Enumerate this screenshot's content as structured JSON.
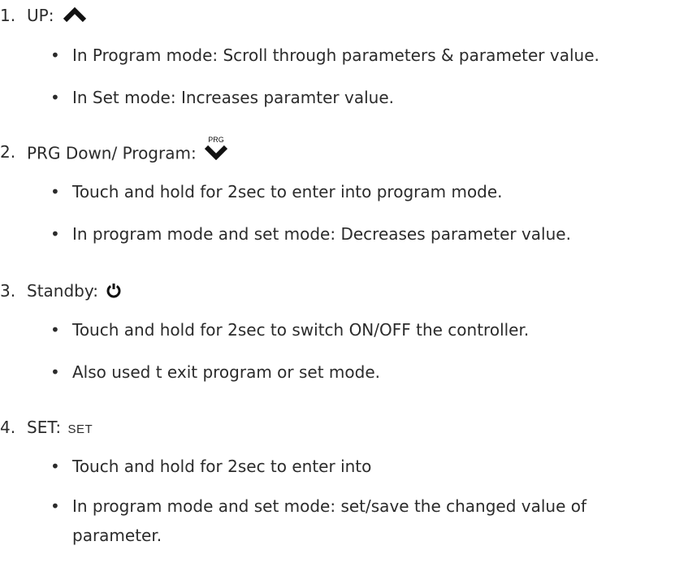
{
  "items": [
    {
      "number": "1.",
      "label": "UP:",
      "icon": "up-chevron-icon",
      "bullets": [
        "In Program mode: Scroll through parameters & parameter value.",
        "In Set mode: Increases paramter value."
      ]
    },
    {
      "number": "2.",
      "label": "PRG Down/ Program:",
      "icon": "down-chevron-prg-icon",
      "icon_caption": "PRG",
      "bullets": [
        "Touch and hold for 2sec to enter into program mode.",
        "In program mode and set mode: Decreases parameter value."
      ]
    },
    {
      "number": "3.",
      "label": "Standby:",
      "icon": "power-icon",
      "bullets": [
        "Touch and hold for 2sec to switch ON/OFF the controller.",
        "Also used t exit program or set mode."
      ]
    },
    {
      "number": "4.",
      "label": "SET:",
      "icon_text": "SET",
      "bullets": [
        "Touch and hold for 2sec to enter into",
        "In program mode and set mode: set/save the changed value of"
      ],
      "continuation": "parameter."
    }
  ]
}
